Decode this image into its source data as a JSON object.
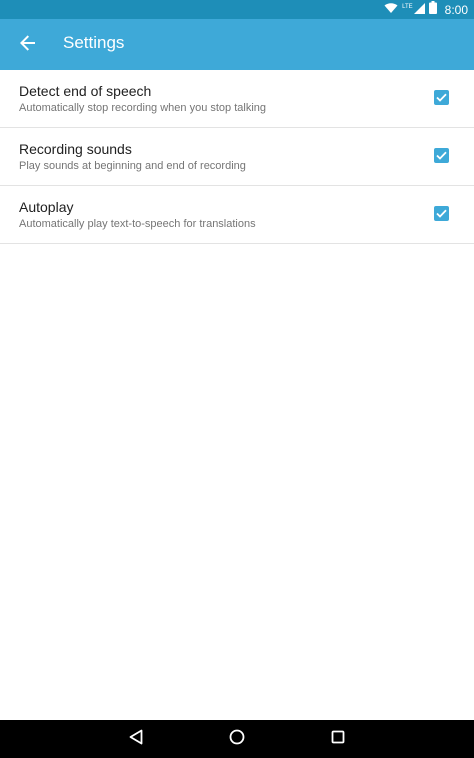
{
  "status_bar": {
    "time": "8:00",
    "network_label": "LTE",
    "icons": [
      "wifi-icon",
      "signal-icon",
      "battery-icon"
    ]
  },
  "app_bar": {
    "title": "Settings",
    "back_icon": "arrow-back-icon",
    "color": "#3ea9d8"
  },
  "settings": [
    {
      "title": "Detect end of speech",
      "summary": "Automatically stop recording when you stop talking",
      "checked": true
    },
    {
      "title": "Recording sounds",
      "summary": "Play sounds at beginning and end of recording",
      "checked": true
    },
    {
      "title": "Autoplay",
      "summary": "Automatically play text-to-speech for translations",
      "checked": true
    }
  ],
  "nav_bar": {
    "buttons": [
      "back-triangle-icon",
      "home-circle-icon",
      "recents-square-icon"
    ]
  }
}
